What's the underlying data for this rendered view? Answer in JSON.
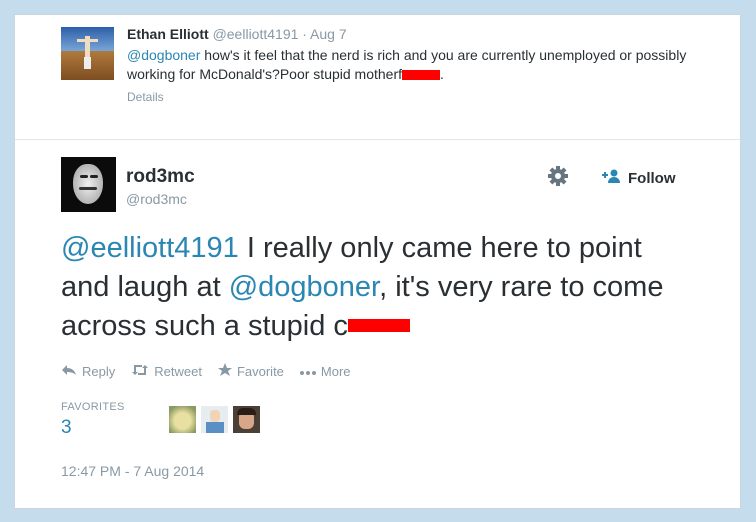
{
  "parent": {
    "name": "Ethan Elliott",
    "handle": "@eelliott4191",
    "time": "· Aug 7",
    "mention": "@dogboner",
    "text_part1": " how's it feel that the nerd is rich and you are currently unemployed or possibly working for McDonald's?Poor stupid motherf",
    "text_end": ".",
    "details": "Details"
  },
  "tweet": {
    "name": "rod3mc",
    "handle": "@rod3mc",
    "follow_label": "Follow",
    "mention1": "@eelliott4191",
    "text_a": "  I really only came here to point and laugh at ",
    "mention2": "@dogboner",
    "text_b": ", it's very rare to come across such a stupid c"
  },
  "actions": {
    "reply": "Reply",
    "retweet": "Retweet",
    "favorite": "Favorite",
    "more": "More"
  },
  "favorites": {
    "label": "FAVORITES",
    "count": "3"
  },
  "timestamp": "12:47 PM - 7 Aug 2014",
  "colors": {
    "link": "#2a86b3",
    "muted": "#8899a6",
    "redaction": "#ff0000"
  }
}
